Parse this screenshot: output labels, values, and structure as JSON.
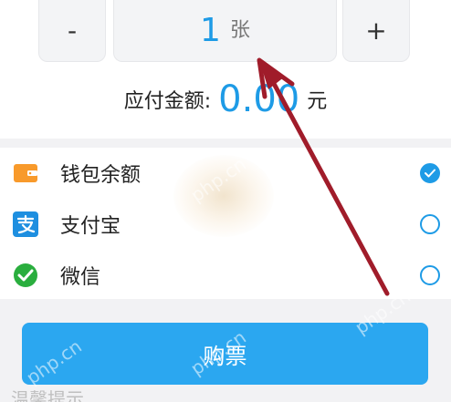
{
  "quantity": {
    "minus_label": "-",
    "plus_label": "+",
    "value": "1",
    "unit": "张"
  },
  "amount": {
    "label": "应付金额:",
    "value": "0.00",
    "unit": "元"
  },
  "payment_methods": [
    {
      "label": "钱包余额",
      "icon": "wallet-icon",
      "icon_color": "#f89a2b",
      "selected": true
    },
    {
      "label": "支付宝",
      "icon": "alipay-icon",
      "icon_color": "#1e8fe0",
      "selected": false
    },
    {
      "label": "微信",
      "icon": "wechat-pay-icon",
      "icon_color": "#2aae3e",
      "selected": false
    }
  ],
  "buy_button_label": "购票",
  "notice_title": "温馨提示",
  "watermark": "php.cn",
  "colors": {
    "accent": "#1e9be6",
    "button": "#2ba7f0",
    "annotation_arrow": "#a01c2a"
  }
}
